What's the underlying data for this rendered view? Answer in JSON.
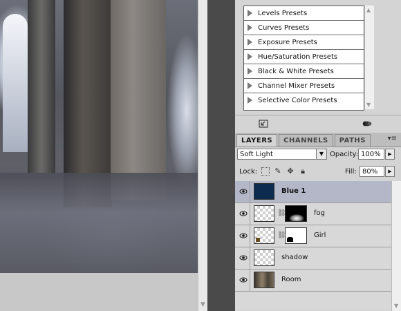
{
  "adjustments": {
    "presets": [
      "Levels Presets",
      "Curves Presets",
      "Exposure Presets",
      "Hue/Saturation Presets",
      "Black & White Presets",
      "Channel Mixer Presets",
      "Selective Color Presets"
    ]
  },
  "layers_panel": {
    "tabs": [
      "LAYERS",
      "CHANNELS",
      "PATHS"
    ],
    "active_tab": "LAYERS",
    "blend_mode": "Soft Light",
    "opacity_label": "Opacity:",
    "opacity_value": "100%",
    "lock_label": "Lock:",
    "fill_label": "Fill:",
    "fill_value": "80%",
    "layers": [
      {
        "name": "Blue 1",
        "selected": true,
        "thumb_color": "#0d2a4f",
        "has_mask": false
      },
      {
        "name": "fog",
        "selected": false,
        "has_mask": true
      },
      {
        "name": "Girl",
        "selected": false,
        "has_mask": true
      },
      {
        "name": "shadow",
        "selected": false,
        "has_mask": false
      },
      {
        "name": "Room",
        "selected": false,
        "has_mask": false
      }
    ]
  },
  "colors": {
    "panel_bg": "#d4d4d4",
    "selected_row": "#b3b7c8",
    "blue_swatch": "#0d2a4f"
  },
  "icons": [
    "eye-icon",
    "triangle-right-icon",
    "chevron-down-icon",
    "chain-icon",
    "panel-menu-icon"
  ]
}
